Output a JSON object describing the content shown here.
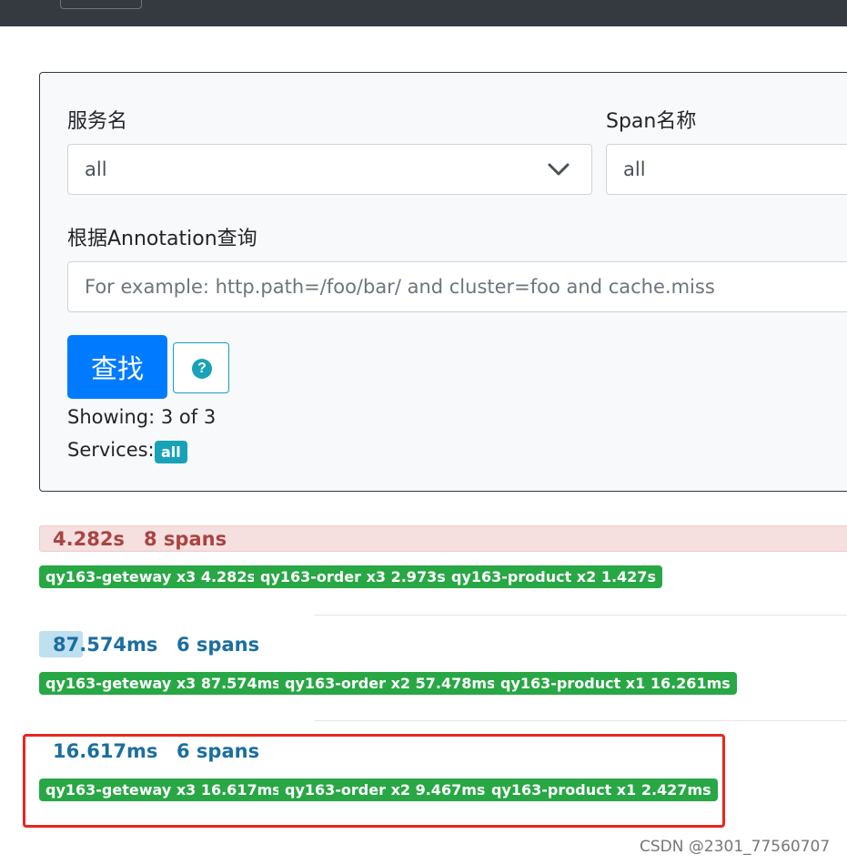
{
  "search": {
    "service_label": "服务名",
    "service_value": "all",
    "span_label": "Span名称",
    "span_value": "all",
    "annotation_label": "根据Annotation查询",
    "annotation_placeholder": "For example: http.path=/foo/bar/ and cluster=foo and cache.miss",
    "annotation_value": "",
    "search_button": "查找",
    "help_icon": "question-circle-icon"
  },
  "results": {
    "showing": "Showing: 3 of 3",
    "services_label": "Services:",
    "services_badge": "all"
  },
  "traces": [
    {
      "duration": "4.282s",
      "spans": "8 spans",
      "services": [
        "qy163-geteway x3 4.282s",
        "qy163-order x3 2.973s",
        "qy163-product x2 1.427s"
      ]
    },
    {
      "duration": "87.574ms",
      "spans": "6 spans",
      "services": [
        "qy163-geteway x3 87.574ms",
        "qy163-order x2 57.478ms",
        "qy163-product x1 16.261ms"
      ]
    },
    {
      "duration": "16.617ms",
      "spans": "6 spans",
      "services": [
        "qy163-geteway x3 16.617ms",
        "qy163-order x2 9.467ms",
        "qy163-product x1 2.427ms"
      ]
    }
  ],
  "watermark": "CSDN @2301_77560707",
  "colors": {
    "navbar": "#343a40",
    "primary": "#007bff",
    "info": "#17a2b8",
    "success": "#28a745",
    "danger_bg": "#f5dfdf",
    "danger_text": "#a94442",
    "highlight": "#e8271f"
  }
}
